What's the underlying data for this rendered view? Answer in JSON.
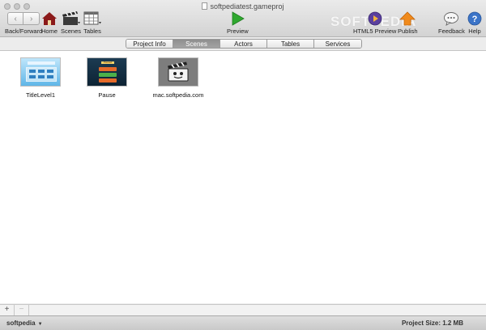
{
  "window": {
    "title": "softpediatest.gameproj"
  },
  "toolbar": {
    "back_forward": "Back/Forward",
    "home": "Home",
    "scenes": "Scenes",
    "tables": "Tables",
    "preview": "Preview",
    "html5_preview": "HTML5 Preview",
    "publish": "Publish",
    "feedback": "Feedback",
    "help": "Help",
    "watermark": "SOFTPEDIA"
  },
  "tabs": [
    {
      "label": "Project Info",
      "active": false
    },
    {
      "label": "Scenes",
      "active": true
    },
    {
      "label": "Actors",
      "active": false
    },
    {
      "label": "Tables",
      "active": false
    },
    {
      "label": "Services",
      "active": false
    }
  ],
  "scenes": [
    {
      "name": "TitleLevel1"
    },
    {
      "name": "Pause",
      "thumb_text": "Paused"
    },
    {
      "name": "mac.softpedia.com"
    }
  ],
  "bottom": {
    "add": "+",
    "remove": "−"
  },
  "status": {
    "user": "softpedia",
    "project_size": "Project Size: 1.2 MB"
  },
  "colors": {
    "active_tab": "#8f8f8f",
    "preview_green": "#2fa82f",
    "publish_orange": "#f08a1c",
    "help_blue": "#3b74c8"
  }
}
